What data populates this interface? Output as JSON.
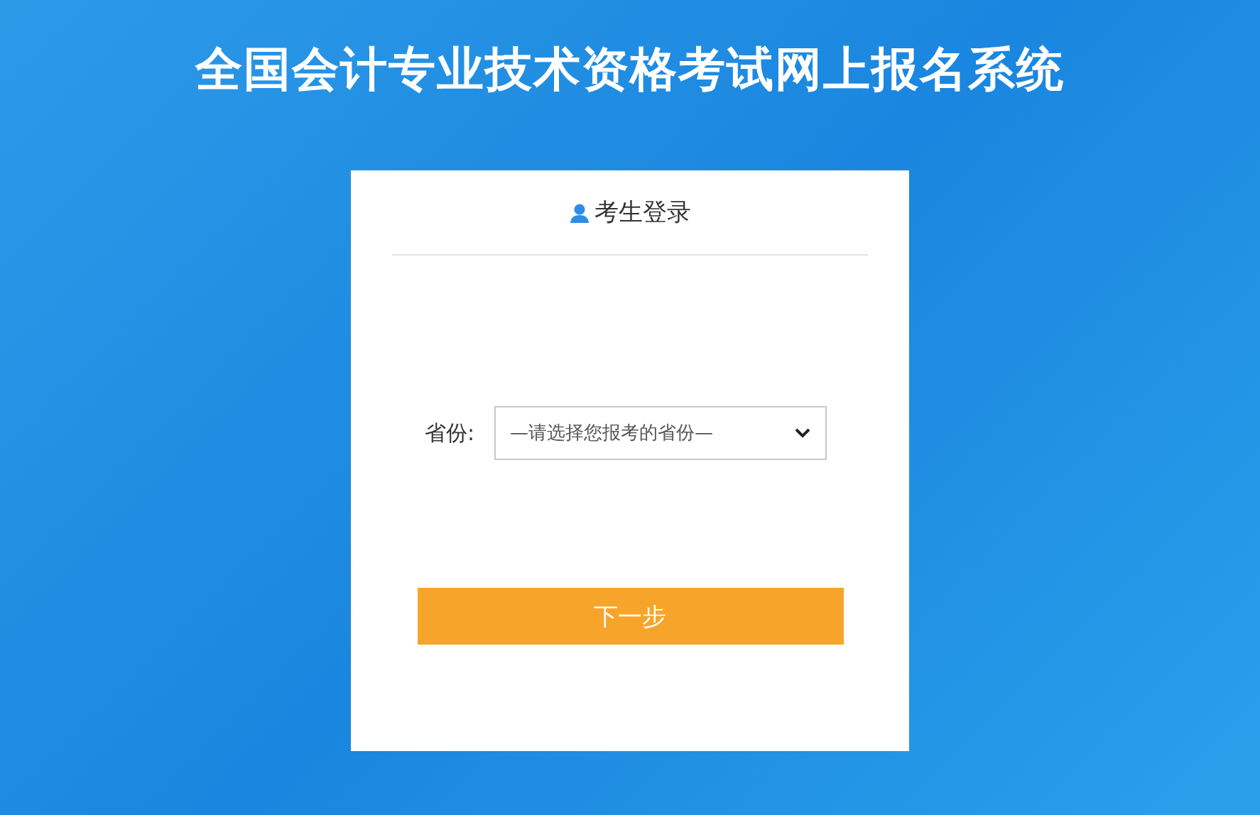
{
  "title": "全国会计专业技术资格考试网上报名系统",
  "login": {
    "heading": "考生登录",
    "fields": [
      {
        "kind": "select",
        "label": "省份:",
        "value": "—请选择您报考的省份—"
      }
    ],
    "button": "下一步"
  }
}
